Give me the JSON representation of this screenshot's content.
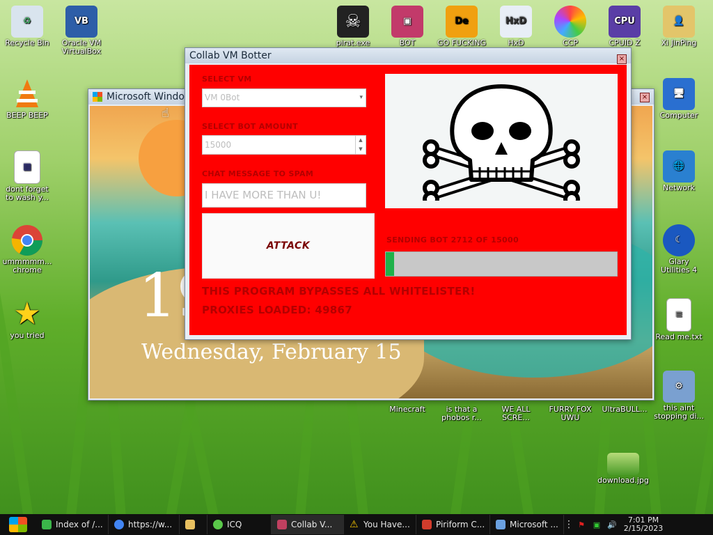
{
  "desktop": {
    "left_icons": [
      {
        "label": "Recycle Bin",
        "icon": "recycle-bin-icon"
      },
      {
        "label": "BEEP BEEP",
        "icon": "vlc-cone-icon"
      },
      {
        "label": "dont forget to wash y...",
        "icon": "document-icon"
      },
      {
        "label": "ummmmm... chrome",
        "icon": "chrome-icon"
      },
      {
        "label": "you tried",
        "icon": "star-icon"
      }
    ],
    "top_icons": [
      {
        "label": "Oracle VM VirtualBox",
        "icon": "virtualbox-icon"
      },
      {
        "label": "pirat.exe",
        "icon": "skull-icon"
      },
      {
        "label": "BOT",
        "icon": "bot-app-icon"
      },
      {
        "label": "GO FUCKING SEX EDITOR",
        "icon": "de-editor-icon"
      },
      {
        "label": "HxD",
        "icon": "hxd-icon"
      },
      {
        "label": "CCP",
        "icon": "ccp-icon"
      },
      {
        "label": "CPUID Z",
        "icon": "cpuz-icon"
      },
      {
        "label": "Xi JinPing",
        "icon": "user-folder-icon"
      }
    ],
    "right_icons": [
      {
        "label": "Computer",
        "icon": "computer-icon"
      },
      {
        "label": "Network",
        "icon": "network-icon"
      },
      {
        "label": "Glary Utilities 4",
        "icon": "glary-icon"
      },
      {
        "label": "Read me.txt",
        "icon": "text-file-icon"
      },
      {
        "label": "this aint stopping di...",
        "icon": "installer-icon"
      },
      {
        "label": "download.jpg",
        "icon": "image-file-icon"
      }
    ],
    "bottom_icons": [
      {
        "label": "Minecraft",
        "icon": "minecraft-icon"
      },
      {
        "label": "is that a phobos r...",
        "icon": "file-icon"
      },
      {
        "label": "WE ALL SCRE...",
        "icon": "file-icon"
      },
      {
        "label": "FURRY FOX UWU",
        "icon": "file-icon"
      },
      {
        "label": "UltraBULL...",
        "icon": "file-icon"
      }
    ]
  },
  "ms_window": {
    "title": "Microsoft Windo",
    "lock_time": "19",
    "lock_date": "Wednesday, February 15"
  },
  "botter": {
    "title": "Collab VM Botter",
    "select_vm_label": "SELECT VM",
    "select_vm_value": "VM 0Bot",
    "bot_amount_label": "SELECT BOT AMOUNT",
    "bot_amount_value": "15000",
    "chat_label": "CHAT MESSAGE TO SPAM",
    "chat_value": "I HAVE MORE THAN U!",
    "attack_label": "ATTACK",
    "status": "SENDING BOT 2712 OF 15000",
    "progress": 0.036,
    "footer_line1": "THIS PROGRAM BYPASSES ALL WHITELISTER!",
    "footer_line2": "PROXIES LOADED: 49867"
  },
  "taskbar": {
    "items": [
      {
        "label": "Index of /...",
        "icon": "chat-icon",
        "color": "#3bb54a"
      },
      {
        "label": "https://w...",
        "icon": "chrome-icon",
        "color": "#4285f4"
      },
      {
        "label": "",
        "icon": "folder-icon",
        "color": "#e8c060"
      },
      {
        "label": "ICQ",
        "icon": "icq-icon",
        "color": "#5ac84a"
      },
      {
        "label": "Collab V...",
        "icon": "bot-app-icon",
        "color": "#c04060"
      },
      {
        "label": "You Have...",
        "icon": "warning-icon",
        "color": "#f2c200"
      },
      {
        "label": "Piriform C...",
        "icon": "ccleaner-icon",
        "color": "#d23c2c"
      },
      {
        "label": "Microsoft ...",
        "icon": "windows-icon",
        "color": "#6aa0e0"
      }
    ],
    "time": "7:01 PM",
    "date": "2/15/2023"
  }
}
